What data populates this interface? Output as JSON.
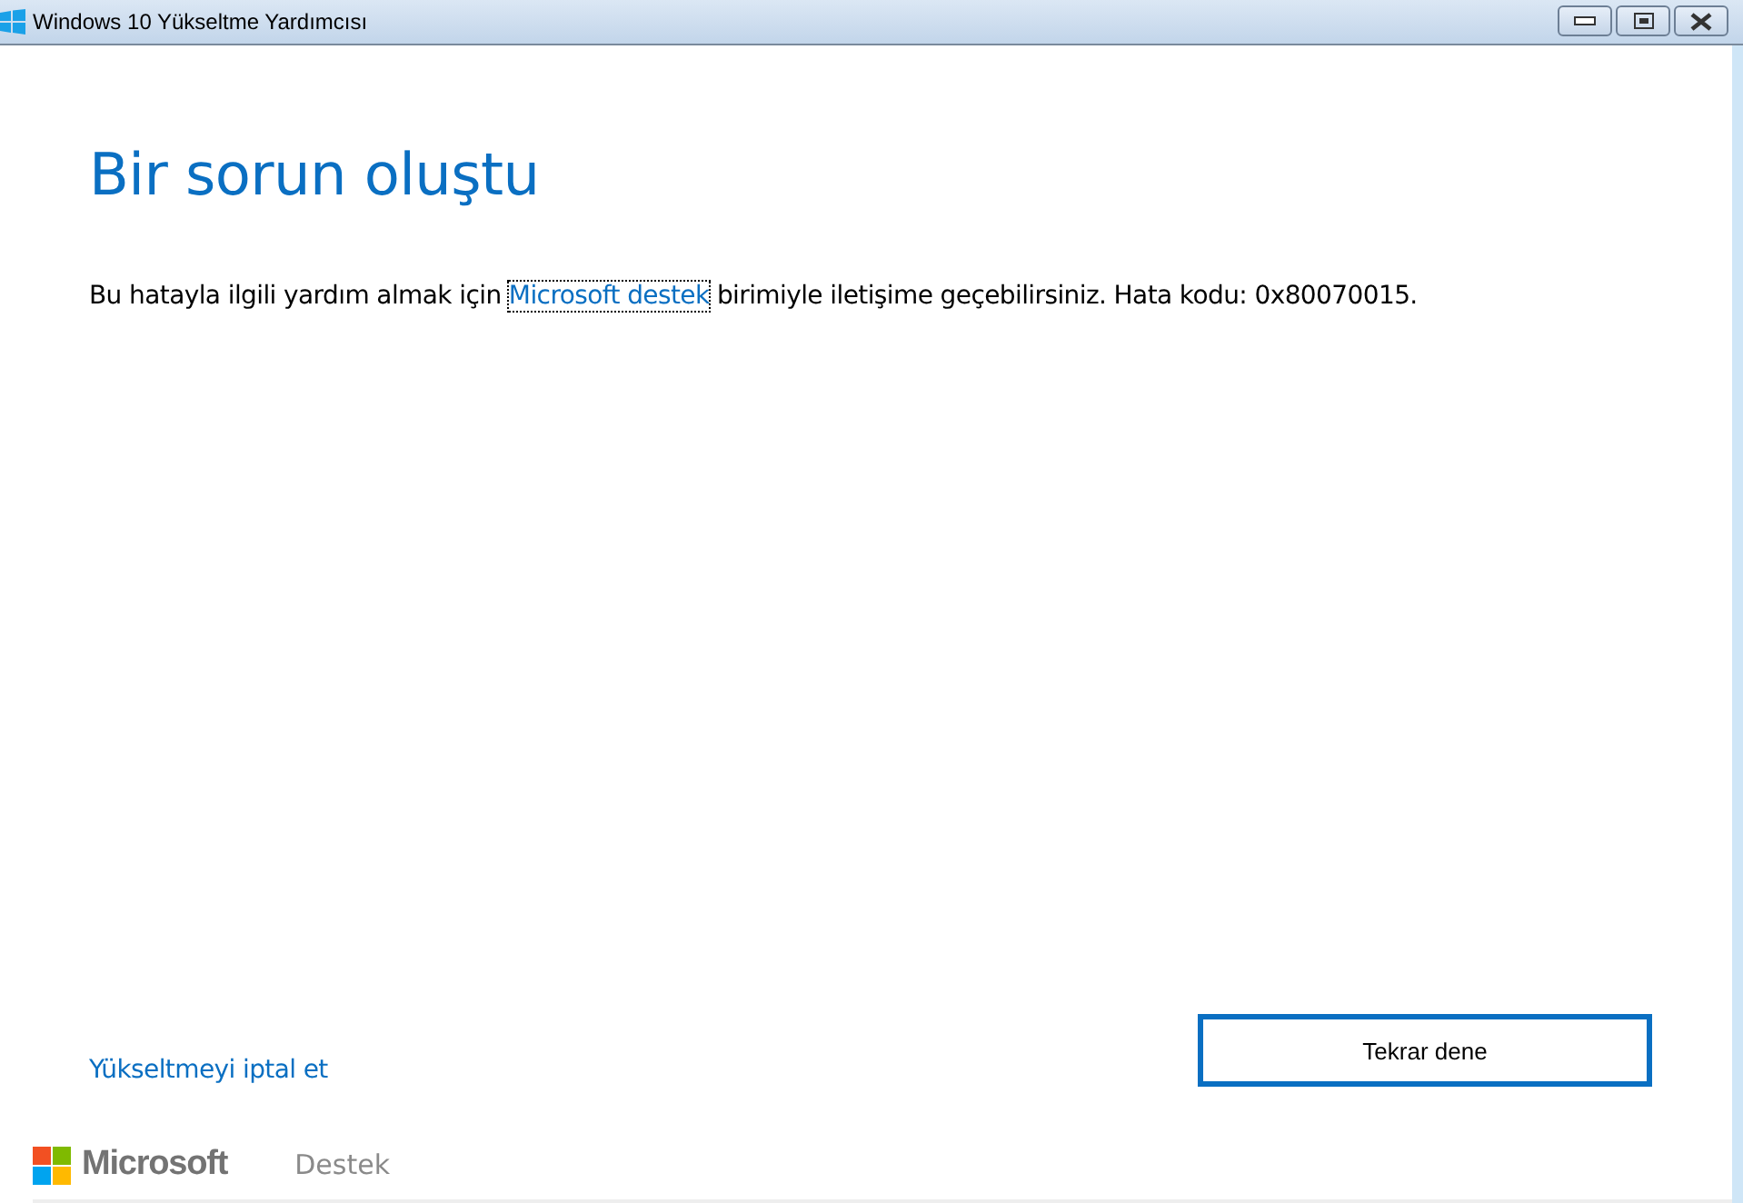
{
  "window": {
    "title": "Windows 10 Yükseltme Yardımcısı"
  },
  "heading": "Bir sorun oluştu",
  "message": {
    "before": "Bu hatayla ilgili yardım almak için ",
    "link": "Microsoft destek",
    "after": " birimiyle iletişime geçebilirsiniz. Hata kodu: 0x80070015."
  },
  "cancel_link": "Yükseltmeyi iptal et",
  "retry_button": "Tekrar dene",
  "footer": {
    "brand": "Microsoft",
    "support_link": "Destek"
  }
}
